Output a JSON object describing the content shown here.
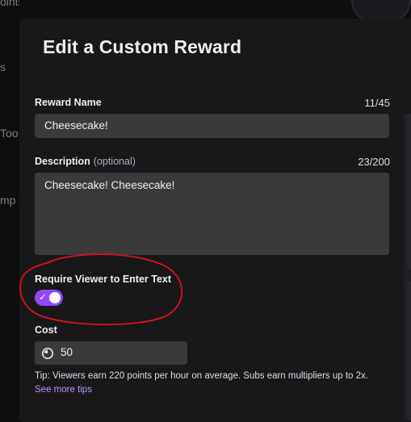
{
  "background": {
    "fragment_1": "oints",
    "fragment_2": "s",
    "fragment_3": "Too",
    "fragment_4": "mp"
  },
  "modal": {
    "title": "Edit a Custom Reward"
  },
  "reward_name": {
    "label": "Reward Name",
    "counter": "11/45",
    "value": "Cheesecake!"
  },
  "description": {
    "label": "Description",
    "optional_label": "(optional)",
    "counter": "23/200",
    "value": "Cheesecake! Cheesecake!"
  },
  "require_text": {
    "label": "Require Viewer to Enter Text",
    "enabled": true,
    "check_glyph": "✓"
  },
  "cost": {
    "label": "Cost",
    "value": "50",
    "icon": "channel-points-icon",
    "tip": "Tip: Viewers earn 220 points per hour on average. Subs earn multipliers up to 2x.",
    "tips_link": "See more tips"
  },
  "colors": {
    "accent": "#9147ff",
    "link": "#bf94ff",
    "annotation": "#e0101a",
    "input_bg": "#3a3a3d",
    "modal_bg": "#18181b"
  }
}
